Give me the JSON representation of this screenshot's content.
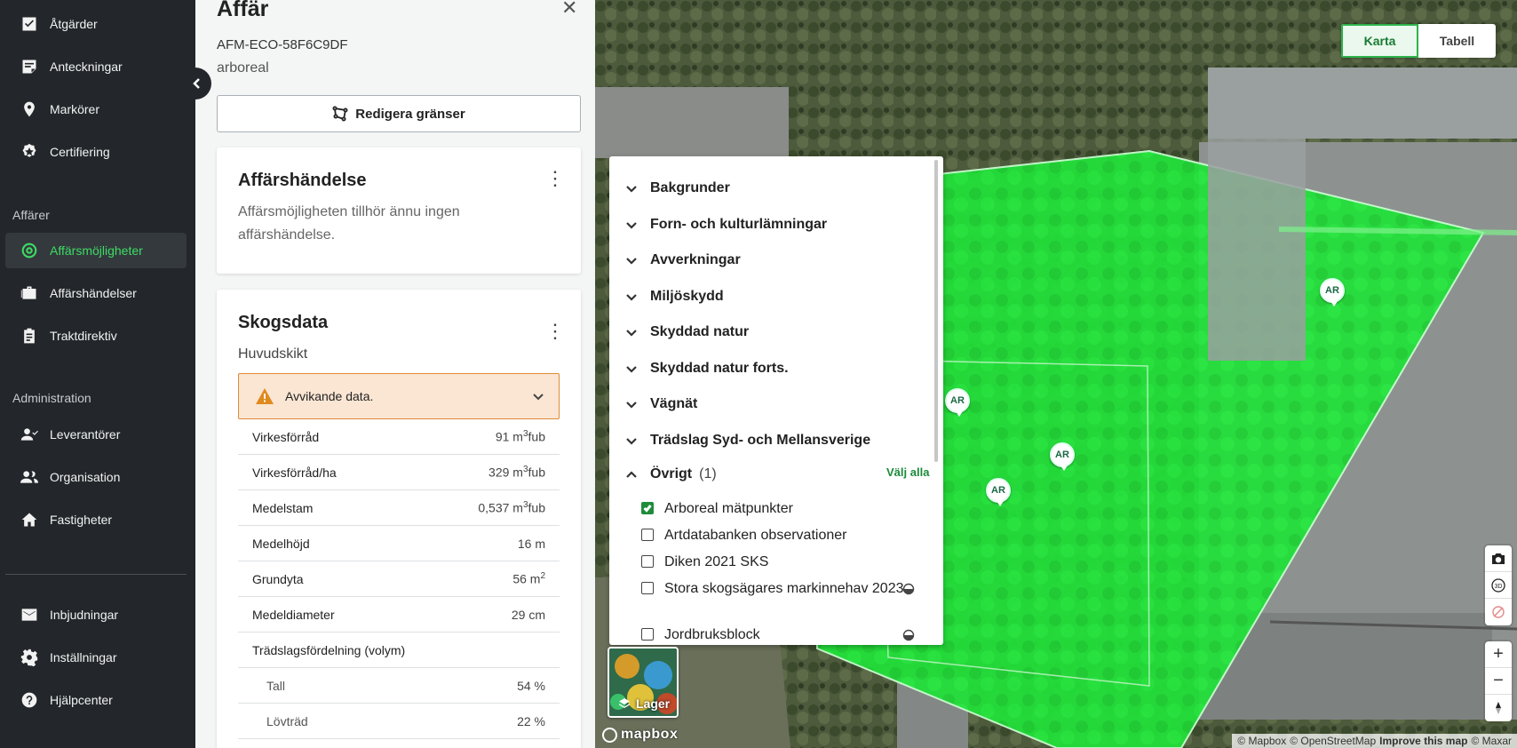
{
  "sidebar": {
    "items_top": [
      {
        "label": "Åtgärder",
        "icon": "checkbox-icon"
      },
      {
        "label": "Anteckningar",
        "icon": "note-icon"
      },
      {
        "label": "Markörer",
        "icon": "map-pin-icon"
      },
      {
        "label": "Certifiering",
        "icon": "badge-star-icon"
      }
    ],
    "section_affarer": "Affärer",
    "items_affarer": [
      {
        "label": "Affärsmöjligheter",
        "icon": "target-icon",
        "active": true
      },
      {
        "label": "Affärshändelser",
        "icon": "briefcase-icon"
      },
      {
        "label": "Traktdirektiv",
        "icon": "clipboard-icon"
      }
    ],
    "section_admin": "Administration",
    "items_admin": [
      {
        "label": "Leverantörer",
        "icon": "supplier-icon"
      },
      {
        "label": "Organisation",
        "icon": "people-icon"
      },
      {
        "label": "Fastigheter",
        "icon": "home-icon"
      }
    ],
    "items_bottom": [
      {
        "label": "Inbjudningar",
        "icon": "mail-icon"
      },
      {
        "label": "Inställningar",
        "icon": "gear-icon"
      },
      {
        "label": "Hjälpcenter",
        "icon": "help-icon"
      }
    ],
    "active_color": "#3ddc63"
  },
  "panel": {
    "title": "Affär",
    "id": "AFM-ECO-58F6C9DF",
    "subtitle": "arboreal",
    "edit_button": "Redigera gränser",
    "card_event": {
      "title": "Affärshändelse",
      "text": "Affärsmöjligheten tillhör ännu ingen affärshändelse."
    },
    "card_forest": {
      "title": "Skogsdata",
      "subtitle": "Huvudskikt",
      "warning": "Avvikande data.",
      "rows": [
        {
          "label": "Virkesförråd",
          "value": "91 m",
          "sup": "3",
          "unit": "fub"
        },
        {
          "label": "Virkesförråd/ha",
          "value": "329 m",
          "sup": "3",
          "unit": "fub"
        },
        {
          "label": "Medelstam",
          "value": "0,537 m",
          "sup": "3",
          "unit": "fub"
        },
        {
          "label": "Medelhöjd",
          "value": "16 m",
          "sup": "",
          "unit": ""
        },
        {
          "label": "Grundyta",
          "value": "56 m",
          "sup": "2",
          "unit": ""
        },
        {
          "label": "Medeldiameter",
          "value": "29 cm",
          "sup": "",
          "unit": ""
        },
        {
          "label": "Trädslagsfördelning (volym)",
          "value": "",
          "sup": "",
          "unit": ""
        },
        {
          "label": "Tall",
          "value": "54 %",
          "sup": "",
          "unit": "",
          "sub": true
        },
        {
          "label": "Lövträd",
          "value": "22 %",
          "sup": "",
          "unit": "",
          "sub": true
        }
      ]
    }
  },
  "map": {
    "toggle": {
      "map": "Karta",
      "table": "Tabell",
      "active": "map"
    },
    "layers": {
      "groups": [
        "Bakgrunder",
        "Forn- och kulturlämningar",
        "Avverkningar",
        "Miljöskydd",
        "Skyddad natur",
        "Skyddad natur forts.",
        "Vägnät",
        "Trädslag Syd- och Mellansverige"
      ],
      "open_group": {
        "label": "Övrigt",
        "count": "(1)",
        "select_all": "Välj alla"
      },
      "items": [
        {
          "label": "Arboreal mätpunkter",
          "checked": true,
          "opacity": false
        },
        {
          "label": "Artdatabanken observationer",
          "checked": false,
          "opacity": false
        },
        {
          "label": "Diken 2021 SKS",
          "checked": false,
          "opacity": false
        },
        {
          "label": "Stora skogsägares markinnehav 2023",
          "checked": false,
          "opacity": true
        },
        {
          "label": "Jordbruksblock",
          "checked": false,
          "opacity": true
        }
      ]
    },
    "layer_button": "Lager",
    "marker_label": "AR",
    "logo": "mapbox",
    "attribution": [
      "© Mapbox",
      "© OpenStreetMap",
      "Improve this map",
      "© Maxar"
    ],
    "polygon_color": "#22e03a"
  }
}
